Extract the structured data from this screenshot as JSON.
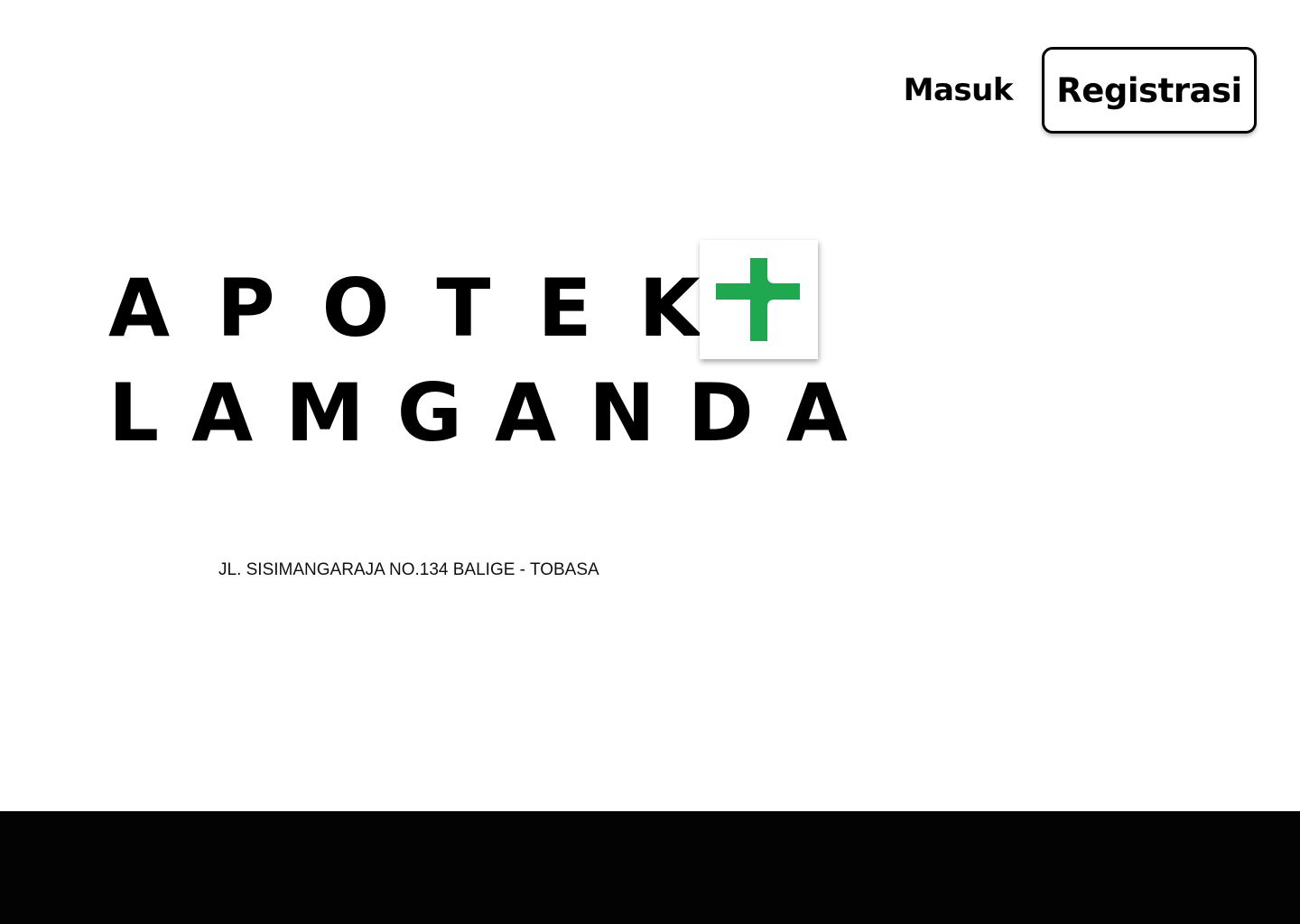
{
  "header": {
    "login_label": "Masuk",
    "register_label": "Registrasi"
  },
  "logo": {
    "line1": "APOTEK",
    "line2": "LAMGANDA",
    "icon": "green-plus-icon",
    "icon_color": "#1fa84f",
    "text_color": "#000000"
  },
  "address": "JL. SISIMANGARAJA NO.134 BALIGE - TOBASA",
  "colors": {
    "background": "#ffffff",
    "footer": "#030303",
    "accent": "#1fa84f"
  }
}
